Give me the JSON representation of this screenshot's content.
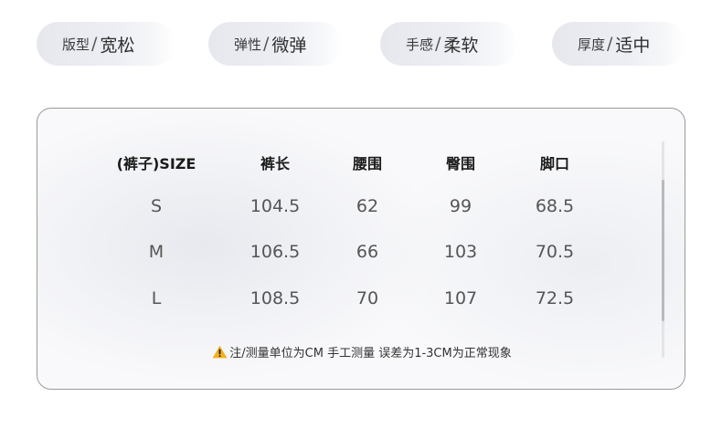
{
  "attributes": [
    {
      "key": "版型",
      "sep": "/",
      "value": "宽松"
    },
    {
      "key": "弹性",
      "sep": "/",
      "value": "微弹"
    },
    {
      "key": "手感",
      "sep": "/",
      "value": "柔软"
    },
    {
      "key": "厚度",
      "sep": "/",
      "value": "适中"
    }
  ],
  "size_table": {
    "headers": [
      "(裤子)SIZE",
      "裤长",
      "腰围",
      "臀围",
      "脚口"
    ],
    "rows": [
      [
        "S",
        "104.5",
        "62",
        "99",
        "68.5"
      ],
      [
        "M",
        "106.5",
        "66",
        "103",
        "70.5"
      ],
      [
        "L",
        "108.5",
        "70",
        "107",
        "72.5"
      ]
    ]
  },
  "note": {
    "icon": "warning-icon",
    "text": "注/测量单位为CM 手工测量 误差为1-3CM为正常现象"
  },
  "colors": {
    "warning": "#f2b01e",
    "card_border": "#9a9a9a"
  }
}
